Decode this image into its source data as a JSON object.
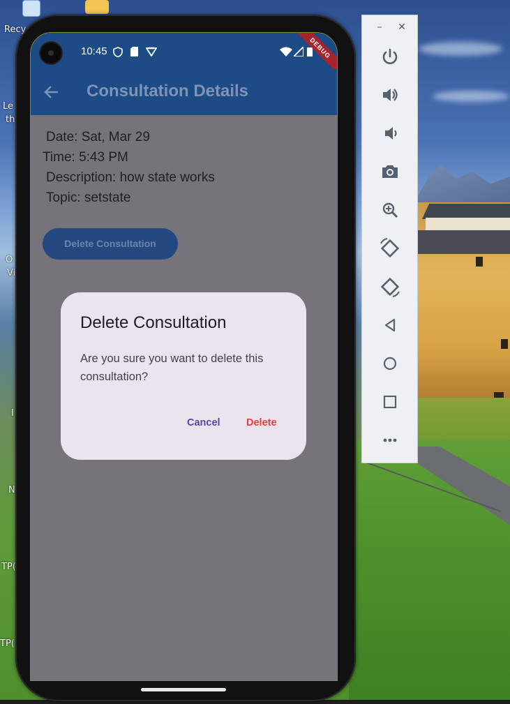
{
  "desktop": {
    "labels": [
      "Recy",
      "Le",
      "th",
      "O",
      "Vi",
      "I",
      "N",
      "TP(",
      "TP("
    ]
  },
  "status_bar": {
    "time": "10:45",
    "debug_label": "DEBUG"
  },
  "app_bar": {
    "title": "Consultation Details",
    "back_icon": "arrow-back-icon"
  },
  "details": {
    "date": "Date: Sat, Mar 29",
    "time": "Time: 5:43 PM",
    "description": "Description: how state works",
    "topic": "Topic: setstate"
  },
  "delete_button": {
    "label": "Delete Consultation"
  },
  "dialog": {
    "title": "Delete Consultation",
    "body": "Are you sure you want to delete this consultation?",
    "cancel_label": "Cancel",
    "confirm_label": "Delete"
  },
  "emulator_toolbar": {
    "window_controls": [
      "minimize-icon",
      "close-icon"
    ],
    "buttons": [
      "power-icon",
      "volume-up-icon",
      "volume-down-icon",
      "camera-icon",
      "zoom-icon",
      "rotate-left-icon",
      "rotate-right-icon",
      "back-icon",
      "home-icon",
      "overview-icon",
      "more-icon"
    ]
  },
  "colors": {
    "app_bar": "#1d4b86",
    "scrim_background": "#77737a",
    "dialog_background": "#ebe4ef",
    "cancel_text": "#5b46a6",
    "delete_text": "#e14040"
  }
}
